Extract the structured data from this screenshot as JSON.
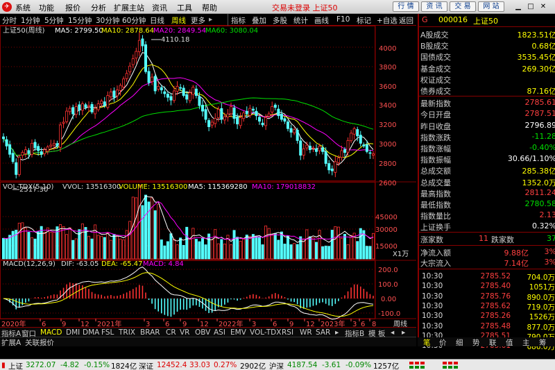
{
  "menu": [
    "系统",
    "功能",
    "报价",
    "分析",
    "扩展主站",
    "资讯",
    "工具",
    "帮助"
  ],
  "app_title": "交易未登录 上证50",
  "top_buttons": [
    "行 情",
    "资 讯",
    "交 易",
    "网 站"
  ],
  "periods": [
    "分时",
    "1分钟",
    "5分钟",
    "15分钟",
    "30分钟",
    "60分钟",
    "日线",
    "周线",
    "更多"
  ],
  "active_period": "周线",
  "tool_buttons": [
    "指标",
    "叠加",
    "多股",
    "统计",
    "画线",
    "F10",
    "标记",
    "+自选",
    "返回"
  ],
  "main_legend": {
    "name": "上证50(周线)",
    "ma5": "MA5: 2799.50",
    "ma10": "MA10: 2878.64",
    "ma20": "MA20: 2849.54",
    "ma60": "MA60: 3080.04"
  },
  "high_marker": "4110.18",
  "low_marker": "2517.30",
  "price_axis": [
    "4000",
    "3800",
    "3600",
    "3400",
    "3200",
    "3000",
    "2800",
    "2600"
  ],
  "vol_legend": {
    "name": "VOL-TDX(5,10)",
    "vvol": "VVOL: 13516300",
    "volume": "VOLUME: 13516300",
    "ma5": "MA5: 115369280",
    "ma10": "MA10: 179018832"
  },
  "vol_axis": [
    "45000",
    "30000",
    "15000"
  ],
  "vol_unit": "X1万",
  "macd_legend": {
    "name": "MACD(12,26,9)",
    "dif": "DIF: -63.05",
    "dea": "DEA: -65.47",
    "macd": "MACD: 4.84"
  },
  "macd_axis": [
    "200.0",
    "100.0",
    "0.00",
    "-100.0"
  ],
  "date_axis": [
    "2020年",
    "6",
    "9",
    "12",
    "2021年",
    "3",
    "6",
    "9",
    "12",
    "2022年",
    "3",
    "6",
    "9",
    "12",
    "2023年",
    "3",
    "6",
    "8"
  ],
  "date_unit": "周线",
  "indicator_tabs": [
    "指标A",
    "窗口",
    "MACD",
    "DMI",
    "DMA",
    "FSL",
    "TRIX",
    "BRAR",
    "CR",
    "VR",
    "OBV",
    "ASI",
    "EMV",
    "VOL-TDX",
    "RSI",
    "WR",
    "SAR"
  ],
  "indicator_tabs_right": [
    "指标B",
    "模 板"
  ],
  "bottom_tabs": [
    "扩展A",
    "关联报价"
  ],
  "stock": {
    "code": "000016",
    "name": "上证50"
  },
  "stats": [
    {
      "label": "A股成交",
      "value": "1823.51亿"
    },
    {
      "label": "B股成交",
      "value": "0.68亿"
    },
    {
      "label": "国债成交",
      "value": "3535.45亿"
    },
    {
      "label": "基金成交",
      "value": "269.30亿"
    },
    {
      "label": "权证成交",
      "value": ""
    },
    {
      "label": "债券成交",
      "value": "87.16亿"
    },
    {
      "label": "最新指数",
      "value": "2785.61"
    },
    {
      "label": "今日开盘",
      "value": "2787.51"
    },
    {
      "label": "昨日收盘",
      "value": "2796.89"
    },
    {
      "label": "指数涨跌",
      "value": "-11.28"
    },
    {
      "label": "指数涨幅",
      "value": "-0.40%"
    },
    {
      "label": "指数振幅",
      "value": "30.66/1.10%"
    },
    {
      "label": "总成交额",
      "value": "285.38亿"
    },
    {
      "label": "总成交量",
      "value": "1352.0万"
    },
    {
      "label": "最高指数",
      "value": "2811.24"
    },
    {
      "label": "最低指数",
      "value": "2780.58"
    },
    {
      "label": "指数量比",
      "value": "2.13"
    },
    {
      "label": "上证换手",
      "value": "0.32%"
    }
  ],
  "updown": {
    "up_label": "涨家数",
    "up": "11",
    "down_label": "跌家数",
    "down": "37"
  },
  "flows": [
    {
      "label": "净流入额",
      "value": "9.88亿",
      "pct": "3%"
    },
    {
      "label": "大宗流入",
      "value": "7.14亿",
      "pct": "3%"
    }
  ],
  "ticks": [
    {
      "time": "10:30",
      "price": "2785.52",
      "vol": "704.0万"
    },
    {
      "time": "10:30",
      "price": "2785.40",
      "vol": "1051万"
    },
    {
      "time": "10:30",
      "price": "2785.76",
      "vol": "890.0万"
    },
    {
      "time": "10:30",
      "price": "2785.62",
      "vol": "719.0万"
    },
    {
      "time": "10:30",
      "price": "2785.26",
      "vol": "1526万"
    },
    {
      "time": "10:30",
      "price": "2785.48",
      "vol": "877.0万"
    },
    {
      "time": "10:30",
      "price": "2785.51",
      "vol": "790.0万"
    },
    {
      "time": "10:30",
      "price": "2785.61",
      "vol": "686.0万"
    }
  ],
  "right_tabs": [
    "笔",
    "价",
    "细",
    "势",
    "联",
    "值",
    "主",
    "筹"
  ],
  "indices": [
    {
      "name": "上证",
      "price": "3272.07",
      "chg": "-4.82",
      "pct": "-0.15%",
      "amt": "1824亿"
    },
    {
      "name": "深证",
      "price": "12452.4",
      "chg": "33.03",
      "pct": "0.27%",
      "amt": "2902亿"
    },
    {
      "name": "沪深",
      "price": "4187.54",
      "chg": "-3.61",
      "pct": "-0.09%",
      "amt": "1257亿"
    }
  ],
  "colors": {
    "up": "#ff3232",
    "down": "#54ffff",
    "ma5": "#ffffff",
    "ma10": "#ffff00",
    "ma20": "#ff00ff",
    "ma60": "#00e000",
    "grid": "#800000"
  },
  "chart_data": {
    "type": "candlestick",
    "interval": "weekly",
    "price_range": [
      2480,
      4180
    ],
    "high": 4110.18,
    "low": 2517.3,
    "closes": [
      2950,
      2870,
      2780,
      2700,
      2560,
      2750,
      2800,
      2830,
      2790,
      2900,
      2850,
      2820,
      2780,
      2830,
      2860,
      2880,
      2900,
      2870,
      3100,
      3130,
      3250,
      3280,
      3220,
      3300,
      3260,
      3330,
      3290,
      3310,
      3240,
      3280,
      3330,
      3360,
      3310,
      3420,
      3460,
      3400,
      3480,
      3530,
      3600,
      3660,
      3740,
      3820,
      3900,
      4020,
      3960,
      3680,
      3560,
      3620,
      3470,
      3520,
      3480,
      3440,
      3400,
      3370,
      3470,
      3520,
      3500,
      3420,
      3380,
      3450,
      3510,
      3420,
      3310,
      3250,
      3160,
      3080,
      3130,
      3170,
      3270,
      3160,
      3190,
      3220,
      3300,
      3170,
      3110,
      3180,
      3230,
      3220,
      3280,
      3260,
      3200,
      3140,
      3100,
      3180,
      3220,
      3300,
      3290,
      3200,
      3160,
      3140,
      3060,
      3020,
      3050,
      2930,
      2770,
      2840,
      2880,
      2830,
      2850,
      2810,
      2870,
      2810,
      2680,
      2610,
      2600,
      2700,
      2740,
      2820,
      2800,
      2930,
      3010,
      3060,
      2980,
      2900,
      2870,
      2810,
      2790,
      2785
    ],
    "volume_axis_max": 50000,
    "macd": {
      "dif": -63.05,
      "dea": -65.47,
      "macd": 4.84
    }
  }
}
